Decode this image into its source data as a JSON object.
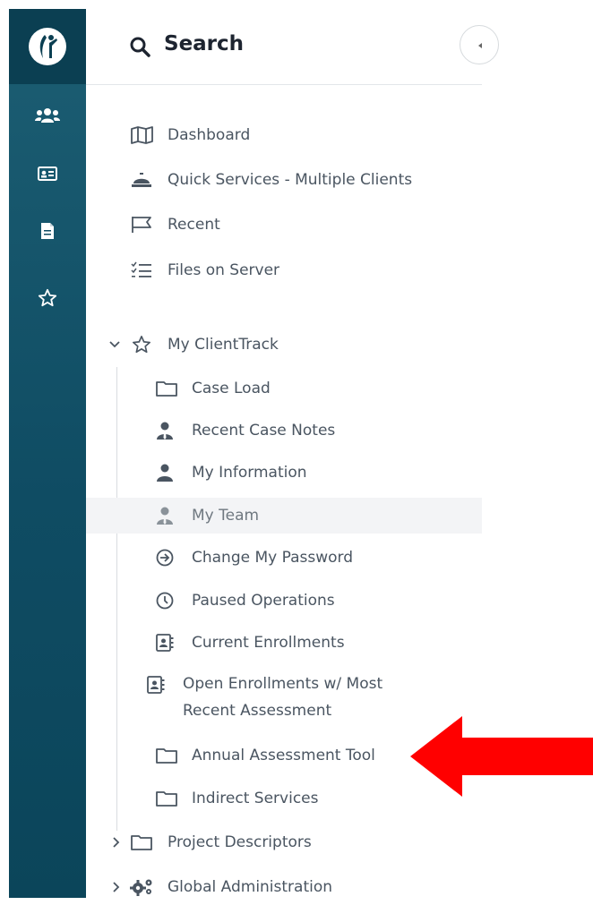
{
  "rail": {
    "logo": "clienttrack-logo",
    "icons": [
      "people-icon",
      "id-card-icon",
      "document-icon",
      "star-icon"
    ]
  },
  "search": {
    "label": "Search"
  },
  "nav": {
    "dashboard": "Dashboard",
    "quick_services": "Quick Services - Multiple Clients",
    "recent": "Recent",
    "files_on_server": "Files on Server",
    "my_clienttrack": "My ClientTrack",
    "case_load": "Case Load",
    "recent_case_notes": "Recent Case Notes",
    "my_information": "My Information",
    "my_team": "My Team",
    "change_password": "Change My Password",
    "paused_operations": "Paused Operations",
    "current_enrollments": "Current Enrollments",
    "open_enrollments_line1": "Open Enrollments w/ Most",
    "open_enrollments_line2": "Recent Assessment",
    "annual_assessment": "Annual Assessment Tool",
    "indirect_services": "Indirect Services",
    "project_descriptors": "Project Descriptors",
    "global_administration": "Global Administration"
  },
  "colors": {
    "rail": "#0f4c63",
    "text": "#4a5561",
    "arrow": "#ff0000",
    "hover": "#f3f4f6"
  }
}
